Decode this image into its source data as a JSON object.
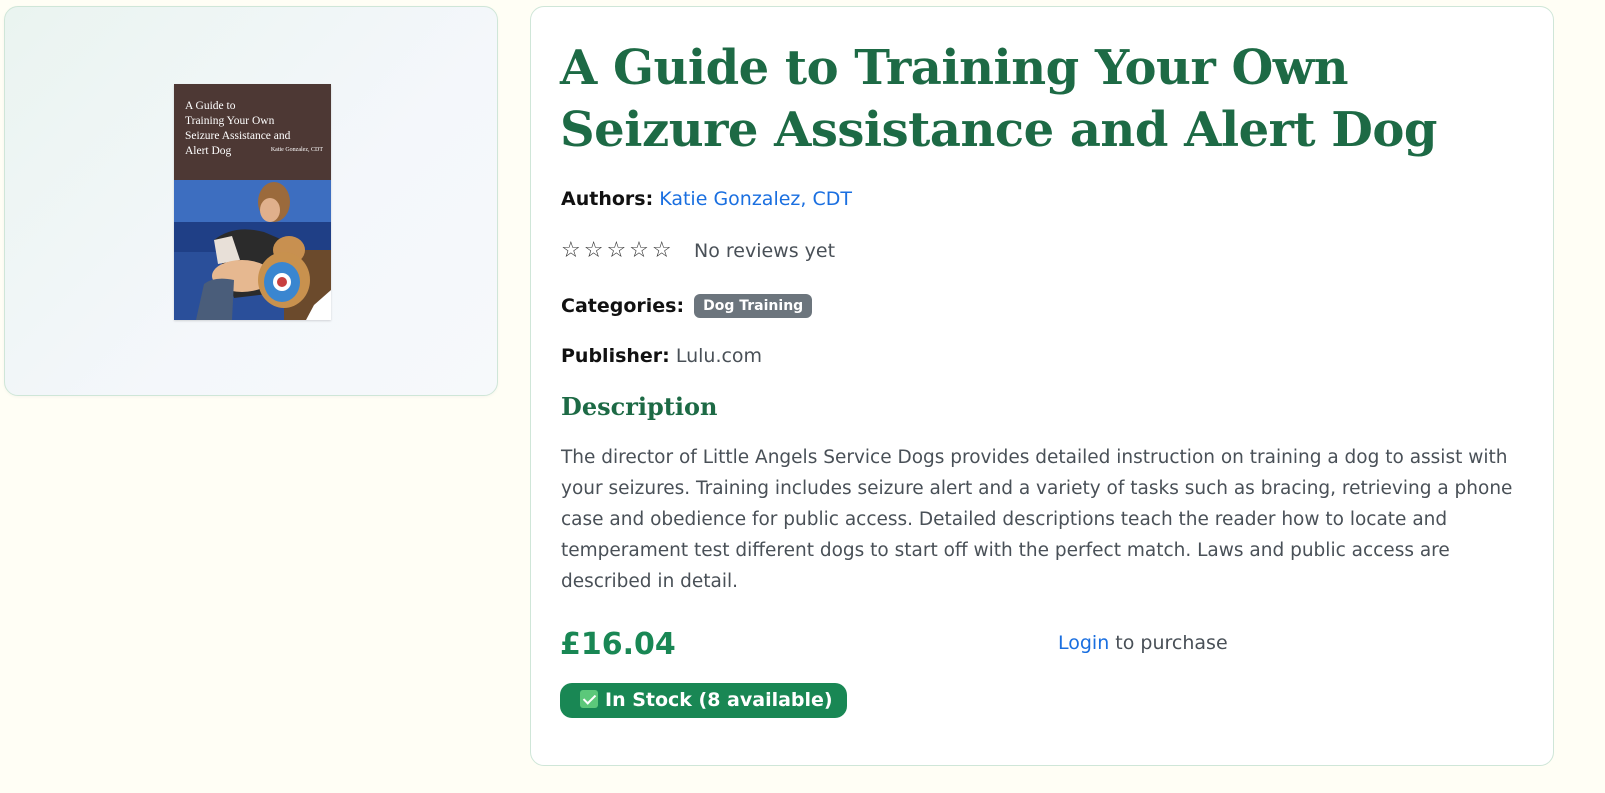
{
  "book": {
    "title": "A Guide to Training Your Own Seizure Assistance and Alert Dog",
    "cover": {
      "title": "A Guide to\nTraining Your Own\nSeizure Assistance and\nAlert Dog",
      "author": "Katie Gonzalez, CDT"
    },
    "authors_label": "Authors:",
    "authors": "Katie Gonzalez, CDT",
    "rating_stars": "☆☆☆☆☆",
    "reviews_text": "No reviews yet",
    "categories_label": "Categories:",
    "category": "Dog Training",
    "publisher_label": "Publisher:",
    "publisher": "Lulu.com",
    "description_heading": "Description",
    "description": "The director of Little Angels Service Dogs provides detailed instruction on training a dog to assist with your seizures. Training includes seizure alert and a variety of tasks such as bracing, retrieving a phone case and obedience for public access. Detailed descriptions teach the reader how to locate and temperament test different dogs to start off with the perfect match. Laws and public access are described in detail.",
    "price": "£16.04",
    "login_link": "Login",
    "purchase_suffix": " to purchase",
    "stock": "In Stock (8 available)"
  },
  "colors": {
    "accent_green": "#1d6a45",
    "price_green": "#198754",
    "link_blue": "#1a6fe0",
    "badge_gray": "#6c757d"
  },
  "icons": {
    "stock_icon": "check-box-icon",
    "rating_icon": "star-outline-icon"
  }
}
